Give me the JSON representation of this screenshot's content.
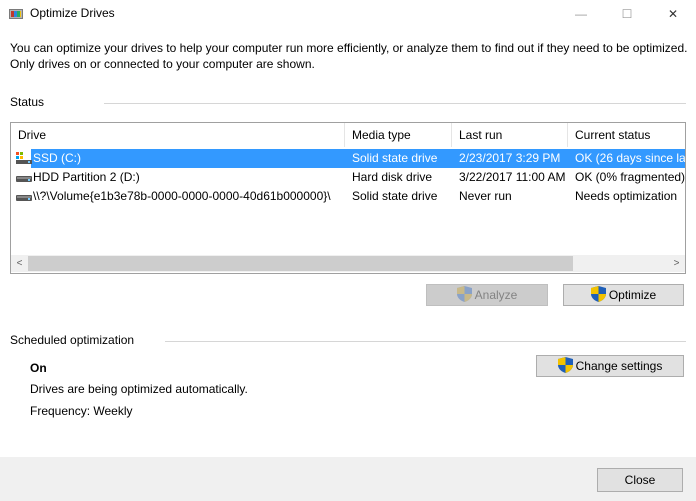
{
  "window": {
    "title": "Optimize Drives",
    "minimize": "—",
    "maximize": "☐",
    "close": "✕"
  },
  "intro": "You can optimize your drives to help your computer run more efficiently, or analyze them to find out if they need to be optimized. Only drives on or connected to your computer are shown.",
  "status": {
    "title": "Status",
    "columns": [
      "Drive",
      "Media type",
      "Last run",
      "Current status"
    ],
    "drives": [
      {
        "icon": "ssd-drive-icon",
        "name": "SSD (C:)",
        "media": "Solid state drive",
        "last_run": "2/23/2017 3:29 PM",
        "status": "OK (26 days since las",
        "selected": true
      },
      {
        "icon": "hdd-drive-icon",
        "name": "HDD Partition 2 (D:)",
        "media": "Hard disk drive",
        "last_run": "3/22/2017 11:00 AM",
        "status": "OK (0% fragmented)",
        "selected": false
      },
      {
        "icon": "volume-drive-icon",
        "name": "\\\\?\\Volume{e1b3e78b-0000-0000-0000-40d61b000000}\\",
        "media": "Solid state drive",
        "last_run": "Never run",
        "status": "Needs optimization",
        "selected": false
      }
    ],
    "scroll_left": "<",
    "scroll_right": ">"
  },
  "actions": {
    "analyze": "Analyze",
    "optimize": "Optimize"
  },
  "schedule": {
    "title": "Scheduled optimization",
    "state": "On",
    "description": "Drives are being optimized automatically.",
    "frequency": "Frequency: Weekly",
    "change": "Change settings"
  },
  "footer": {
    "close": "Close"
  },
  "colors": {
    "selection": "#3399ff",
    "shield_blue": "#1f5fb8",
    "shield_yellow": "#f2c200"
  }
}
